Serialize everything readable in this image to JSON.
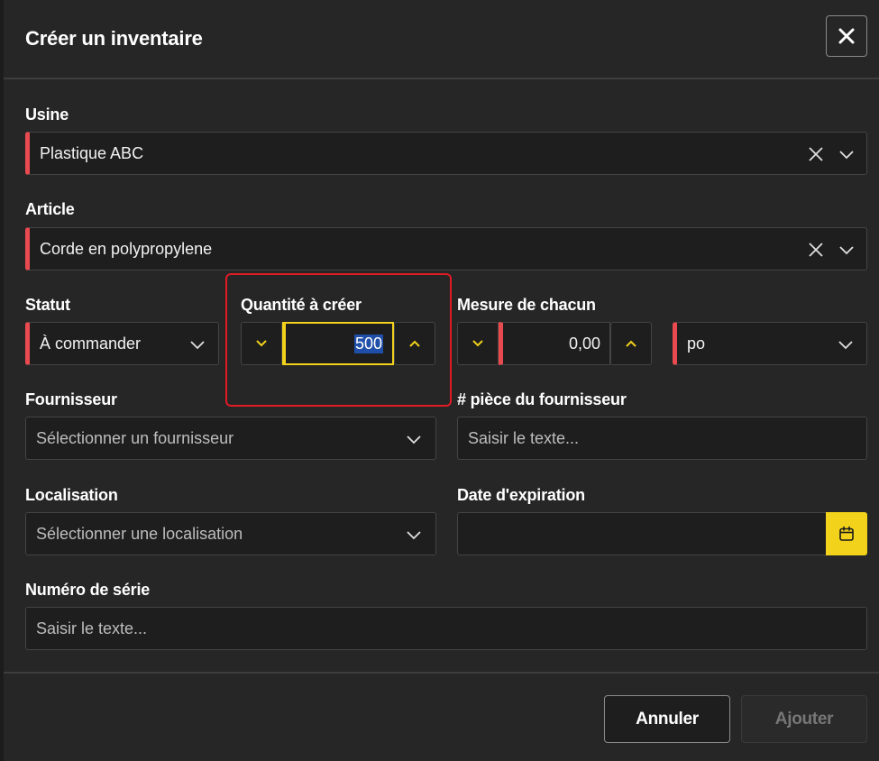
{
  "dialog": {
    "title": "Créer un inventaire"
  },
  "form": {
    "usine": {
      "label": "Usine",
      "value": "Plastique ABC"
    },
    "article": {
      "label": "Article",
      "value": "Corde en polypropylene"
    },
    "statut": {
      "label": "Statut",
      "value": "À commander"
    },
    "quantite": {
      "label": "Quantité à créer",
      "value": "500"
    },
    "mesure": {
      "label": "Mesure de chacun",
      "value": "0,00",
      "unit": "po"
    },
    "fournisseur": {
      "label": "Fournisseur",
      "placeholder": "Sélectionner un fournisseur"
    },
    "piece": {
      "label": "# pièce du fournisseur",
      "placeholder": "Saisir le texte..."
    },
    "localisation": {
      "label": "Localisation",
      "placeholder": "Sélectionner une localisation"
    },
    "expiration": {
      "label": "Date d'expiration",
      "value": ""
    },
    "serie": {
      "label": "Numéro de série",
      "placeholder": "Saisir le texte..."
    }
  },
  "footer": {
    "cancel_label": "Annuler",
    "add_label": "Ajouter"
  },
  "colors": {
    "background": "#262626",
    "required_marker": "#e84a4f",
    "accent_yellow": "#f2d21b",
    "highlight_red": "#e01b24"
  },
  "icons": {
    "close": "close-icon",
    "clear": "clear-icon",
    "dropdown": "chevron-down-icon",
    "decrement": "chevron-down-icon",
    "increment": "chevron-up-icon",
    "calendar": "calendar-icon"
  }
}
